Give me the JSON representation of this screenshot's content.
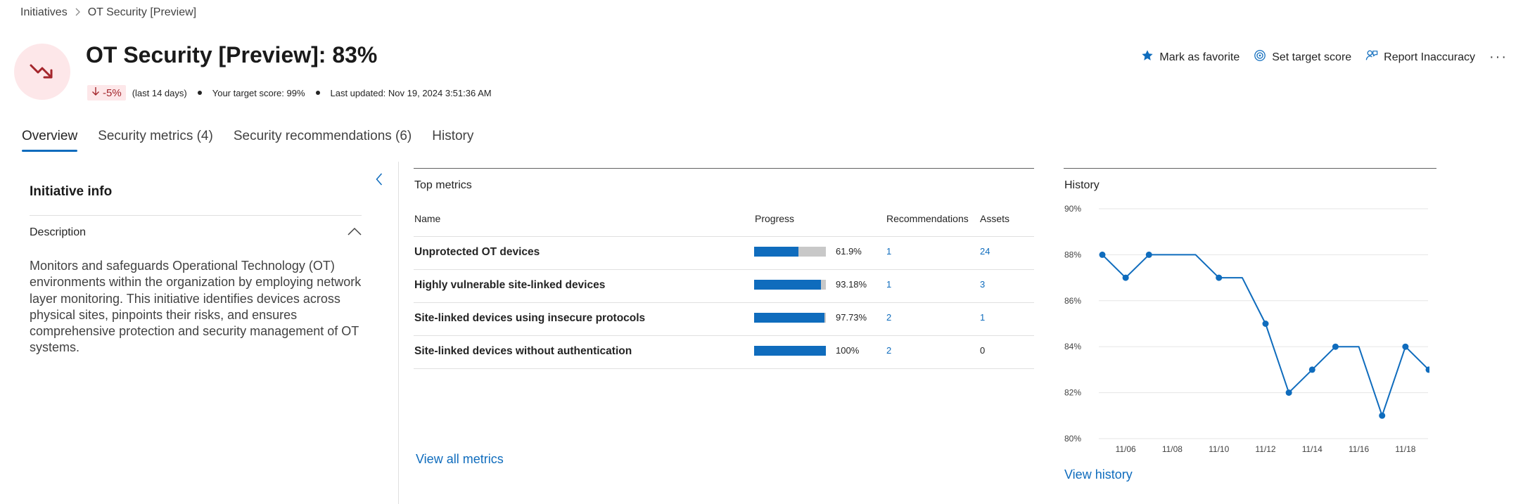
{
  "breadcrumb": {
    "root": "Initiatives",
    "current": "OT Security [Preview]"
  },
  "header": {
    "icon": "trending-down-icon",
    "title": "OT Security [Preview]: 83%",
    "trend": "-5%",
    "trend_period": "(last 14 days)",
    "target": "Your target score: 99%",
    "updated": "Last updated: Nov 19, 2024 3:51:36 AM"
  },
  "toolbar": {
    "favorite": "Mark as favorite",
    "target_score": "Set target score",
    "report": "Report Inaccuracy",
    "more": "···"
  },
  "tabs": [
    "Overview",
    "Security metrics (4)",
    "Security recommendations (6)",
    "History"
  ],
  "left_panel": {
    "title": "Initiative info",
    "description_header": "Description",
    "description": "Monitors and safeguards Operational Technology (OT) environments within the organization by employing network layer monitoring. This initiative identifies devices across physical sites, pinpoints their risks, and ensures comprehensive protection and security management of OT systems."
  },
  "metrics": {
    "title": "Top metrics",
    "columns": {
      "name": "Name",
      "progress": "Progress",
      "recommendations": "Recommendations",
      "assets": "Assets"
    },
    "rows": [
      {
        "name": "Unprotected OT devices",
        "progress": 61.9,
        "progress_label": "61.9%",
        "recommendations": "1",
        "assets": "24",
        "assets_link": true
      },
      {
        "name": "Highly vulnerable site-linked devices",
        "progress": 93.18,
        "progress_label": "93.18%",
        "recommendations": "1",
        "assets": "3",
        "assets_link": true
      },
      {
        "name": "Site-linked devices using insecure protocols",
        "progress": 97.73,
        "progress_label": "97.73%",
        "recommendations": "2",
        "assets": "1",
        "assets_link": true
      },
      {
        "name": "Site-linked devices without authentication",
        "progress": 100,
        "progress_label": "100%",
        "recommendations": "2",
        "assets": "0",
        "assets_link": false
      }
    ],
    "view_all": "View all metrics"
  },
  "history": {
    "title": "History",
    "view_link": "View history"
  },
  "chart_data": {
    "type": "line",
    "title": "History",
    "y_ticks": [
      "90%",
      "88%",
      "86%",
      "84%",
      "82%",
      "80%"
    ],
    "x_ticks": [
      "11/06",
      "11/08",
      "11/10",
      "11/12",
      "11/14",
      "11/16",
      "11/18"
    ],
    "ylim": [
      80,
      90
    ],
    "xlim": [
      "11/05",
      "11/19"
    ],
    "grid": true,
    "color": "#0f6cbd",
    "x": [
      "11/05",
      "11/06",
      "11/07",
      "11/08",
      "11/09",
      "11/10",
      "11/11",
      "11/12",
      "11/13",
      "11/14",
      "11/15",
      "11/16",
      "11/17",
      "11/18",
      "11/19"
    ],
    "values": [
      88,
      87,
      88,
      88,
      88,
      87,
      87,
      85,
      82,
      83,
      84,
      84,
      81,
      84,
      83
    ],
    "markers": [
      true,
      true,
      true,
      false,
      false,
      true,
      false,
      true,
      true,
      true,
      true,
      false,
      true,
      true,
      true
    ]
  }
}
